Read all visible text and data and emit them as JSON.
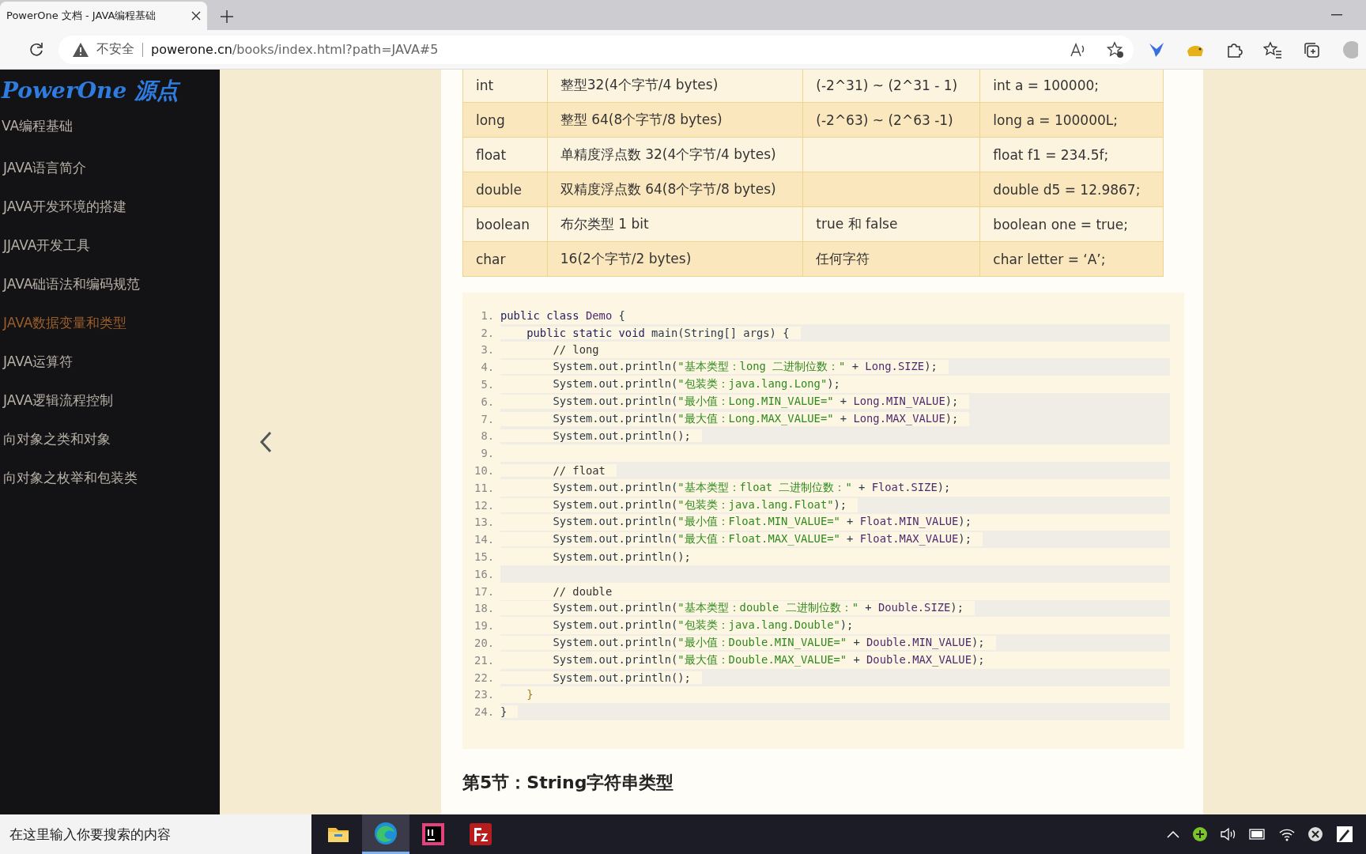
{
  "browser": {
    "tab": {
      "title": "PowerOne 文档 - JAVA编程基础",
      "selected": true
    },
    "security": "不安全",
    "url_domain": "powerone.cn",
    "url_path": "/books/index.html?path=JAVA#5"
  },
  "sidebar": {
    "logo": "PowerOne 源点",
    "section": "VA编程基础",
    "items": [
      {
        "label": "JAVA语言简介",
        "selected": false
      },
      {
        "label": "JAVA开发环境的搭建",
        "selected": false
      },
      {
        "label": "JJAVA开发工具",
        "selected": false
      },
      {
        "label": "JAVA础语法和编码规范",
        "selected": false
      },
      {
        "label": "JAVA数据变量和类型",
        "selected": true
      },
      {
        "label": "JAVA运算符",
        "selected": false
      },
      {
        "label": "JAVA逻辑流程控制",
        "selected": false
      },
      {
        "label": "向对象之类和对象",
        "selected": false
      },
      {
        "label": "向对象之枚举和包装类",
        "selected": false
      }
    ]
  },
  "table": {
    "rows": [
      [
        "int",
        "整型32(4个字节/4 bytes)",
        "(-2^31) ~ (2^31 - 1)",
        "int a = 100000;"
      ],
      [
        "long",
        "整型 64(8个字节/8 bytes)",
        "(-2^63)  ~  (2^63 -1)",
        "long a = 100000L;"
      ],
      [
        "float",
        "单精度浮点数 32(4个字节/4 bytes)",
        "",
        "float f1 = 234.5f;"
      ],
      [
        "double",
        "双精度浮点数 64(8个字节/8 bytes)",
        "",
        "double d5 = 12.9867;"
      ],
      [
        "boolean",
        "布尔类型 1 bit",
        "true 和 false",
        "boolean one = true;"
      ],
      [
        "char",
        "16(2个字节/2 bytes)",
        "任何字符",
        "char letter =  ‘A’;"
      ]
    ]
  },
  "code": [
    {
      "number": "1.",
      "shaded": false,
      "code": [
        {
          "text": "public class ",
          "kind": "kw"
        },
        {
          "text": "Demo",
          "kind": "type"
        },
        {
          "text": " {",
          "kind": "plain"
        }
      ]
    },
    {
      "number": "2.",
      "shaded": true,
      "code": [
        {
          "text": "    public static void ",
          "kind": "kw"
        },
        {
          "text": "main(String[] args) {",
          "kind": "plain"
        }
      ]
    },
    {
      "number": "3.",
      "shaded": false,
      "code": [
        {
          "text": "        // long",
          "kind": "cm"
        }
      ]
    },
    {
      "number": "4.",
      "shaded": true,
      "code": [
        {
          "text": "        System.out.println(",
          "kind": "plain"
        },
        {
          "text": "\"基本类型：long 二进制位数：\"",
          "kind": "str"
        },
        {
          "text": " + ",
          "kind": "plain"
        },
        {
          "text": "Long.SIZE",
          "kind": "type"
        },
        {
          "text": ");",
          "kind": "plain"
        }
      ]
    },
    {
      "number": "5.",
      "shaded": false,
      "code": [
        {
          "text": "        System.out.println(",
          "kind": "plain"
        },
        {
          "text": "\"包装类：java.lang.Long\"",
          "kind": "str"
        },
        {
          "text": ");",
          "kind": "plain"
        }
      ]
    },
    {
      "number": "6.",
      "shaded": true,
      "code": [
        {
          "text": "        System.out.println(",
          "kind": "plain"
        },
        {
          "text": "\"最小值：Long.MIN_VALUE=\"",
          "kind": "str"
        },
        {
          "text": " + ",
          "kind": "plain"
        },
        {
          "text": "Long.MIN_VALUE",
          "kind": "type"
        },
        {
          "text": ");",
          "kind": "plain"
        }
      ]
    },
    {
      "number": "7.",
      "shaded": true,
      "code": [
        {
          "text": "        System.out.println(",
          "kind": "plain"
        },
        {
          "text": "\"最大值：Long.MAX_VALUE=\"",
          "kind": "str"
        },
        {
          "text": " + ",
          "kind": "plain"
        },
        {
          "text": "Long.MAX_VALUE",
          "kind": "type"
        },
        {
          "text": ");",
          "kind": "plain"
        }
      ]
    },
    {
      "number": "8.",
      "shaded": true,
      "code": [
        {
          "text": "        System.out.println();",
          "kind": "plain"
        }
      ]
    },
    {
      "number": "9.",
      "shaded": false
    },
    {
      "number": "10.",
      "shaded": true,
      "code": [
        {
          "text": "        // float",
          "kind": "cm"
        }
      ]
    },
    {
      "number": "11.",
      "shaded": false,
      "code": [
        {
          "text": "        System.out.println(",
          "kind": "plain"
        },
        {
          "text": "\"基本类型：float 二进制位数：\"",
          "kind": "str"
        },
        {
          "text": " + ",
          "kind": "plain"
        },
        {
          "text": "Float.SIZE",
          "kind": "type"
        },
        {
          "text": ");",
          "kind": "plain"
        }
      ]
    },
    {
      "number": "12.",
      "shaded": true,
      "code": [
        {
          "text": "        System.out.println(",
          "kind": "plain"
        },
        {
          "text": "\"包装类：java.lang.Float\"",
          "kind": "str"
        },
        {
          "text": ");",
          "kind": "plain"
        }
      ]
    },
    {
      "number": "13.",
      "shaded": false,
      "code": [
        {
          "text": "        System.out.println(",
          "kind": "plain"
        },
        {
          "text": "\"最小值：Float.MIN_VALUE=\"",
          "kind": "str"
        },
        {
          "text": " + ",
          "kind": "plain"
        },
        {
          "text": "Float.MIN_VALUE",
          "kind": "type"
        },
        {
          "text": ");",
          "kind": "plain"
        }
      ]
    },
    {
      "number": "14.",
      "shaded": true,
      "code": [
        {
          "text": "        System.out.println(",
          "kind": "plain"
        },
        {
          "text": "\"最大值：Float.MAX_VALUE=\"",
          "kind": "str"
        },
        {
          "text": " + ",
          "kind": "plain"
        },
        {
          "text": "Float.MAX_VALUE",
          "kind": "type"
        },
        {
          "text": ");",
          "kind": "plain"
        }
      ]
    },
    {
      "number": "15.",
      "shaded": false,
      "code": [
        {
          "text": "        System.out.println();",
          "kind": "plain"
        }
      ]
    },
    {
      "number": "16.",
      "shaded": true
    },
    {
      "number": "17.",
      "shaded": false,
      "code": [
        {
          "text": "        // double",
          "kind": "cm"
        }
      ]
    },
    {
      "number": "18.",
      "shaded": true,
      "code": [
        {
          "text": "        System.out.println(",
          "kind": "plain"
        },
        {
          "text": "\"基本类型：double 二进制位数：\"",
          "kind": "str"
        },
        {
          "text": " + ",
          "kind": "plain"
        },
        {
          "text": "Double.SIZE",
          "kind": "type"
        },
        {
          "text": ");",
          "kind": "plain"
        }
      ]
    },
    {
      "number": "19.",
      "shaded": false,
      "code": [
        {
          "text": "        System.out.println(",
          "kind": "plain"
        },
        {
          "text": "\"包装类：java.lang.Double\"",
          "kind": "str"
        },
        {
          "text": ");",
          "kind": "plain"
        }
      ]
    },
    {
      "number": "20.",
      "shaded": true,
      "code": [
        {
          "text": "        System.out.println(",
          "kind": "plain"
        },
        {
          "text": "\"最小值：Double.MIN_VALUE=\"",
          "kind": "str"
        },
        {
          "text": " + ",
          "kind": "plain"
        },
        {
          "text": "Double.MIN_VALUE",
          "kind": "type"
        },
        {
          "text": ");",
          "kind": "plain"
        }
      ]
    },
    {
      "number": "21.",
      "shaded": false,
      "code": [
        {
          "text": "        System.out.println(",
          "kind": "plain"
        },
        {
          "text": "\"最大值：Double.MAX_VALUE=\"",
          "kind": "str"
        },
        {
          "text": " + ",
          "kind": "plain"
        },
        {
          "text": "Double.MAX_VALUE",
          "kind": "type"
        },
        {
          "text": ");",
          "kind": "plain"
        }
      ]
    },
    {
      "number": "22.",
      "shaded": true,
      "code": [
        {
          "text": "        System.out.println();",
          "kind": "plain"
        }
      ]
    },
    {
      "number": "23.",
      "shaded": false,
      "code": [
        {
          "text": "    }",
          "kind": "brace"
        }
      ]
    },
    {
      "number": "24.",
      "shaded": true,
      "code": [
        {
          "text": "}",
          "kind": "plain"
        }
      ]
    }
  ],
  "heading": "第5节：String字符串类型",
  "taskbar": {
    "search": {
      "placeholder": "在这里输入你要搜索的内容"
    },
    "apps": [
      {
        "kind": "folder",
        "selected": false
      },
      {
        "kind": "browser",
        "selected": true
      },
      {
        "kind": "ide",
        "selected": false
      },
      {
        "kind": "ftp",
        "selected": false
      }
    ]
  }
}
